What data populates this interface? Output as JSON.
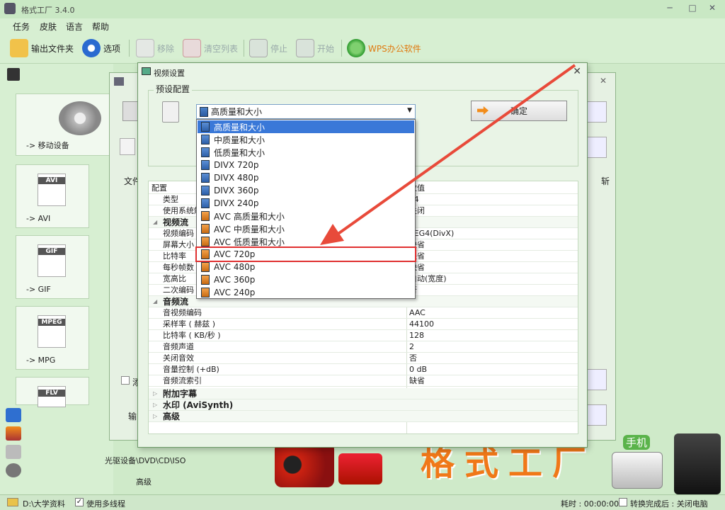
{
  "app": {
    "title": "格式工厂 3.4.0"
  },
  "window_controls": {
    "min": "─",
    "max": "□",
    "close": "✕"
  },
  "menu": [
    "任务",
    "皮肤",
    "语言",
    "帮助"
  ],
  "toolbar": {
    "output_folder": "输出文件夹",
    "options": "选项",
    "remove": "移除",
    "clear_list": "清空列表",
    "stop": "停止",
    "start": "开始",
    "wps": "WPS办公软件"
  },
  "left": {
    "mobile": "-> 移动设备",
    "avi_tag": "AVI",
    "avi": "-> AVI",
    "gif_tag": "GIF",
    "gif": "-> GIF",
    "mpeg_tag": "MPEG",
    "mpg": "-> MPG",
    "flv_tag": "FLV"
  },
  "bgdialog": {
    "file_col": "文件",
    "cut_col": "斩",
    "output_lbl": "输",
    "check_lbl": "添"
  },
  "bottom": {
    "device_label": "光驱设备\\DVD\\CD\\ISO",
    "advanced": "高级",
    "brand_text": "格式工厂",
    "phone_text": "手机"
  },
  "dialog": {
    "title": "视频设置",
    "preset_group": "预设配置",
    "selected": "高质量和大小",
    "ok": "确定",
    "options": [
      {
        "label": "高质量和大小",
        "icon": "blue",
        "selected": true
      },
      {
        "label": "中质量和大小",
        "icon": "blue"
      },
      {
        "label": "低质量和大小",
        "icon": "blue"
      },
      {
        "label": "DIVX 720p",
        "icon": "blue"
      },
      {
        "label": "DIVX 480p",
        "icon": "blue"
      },
      {
        "label": "DIVX 360p",
        "icon": "blue"
      },
      {
        "label": "DIVX 240p",
        "icon": "blue"
      },
      {
        "label": "AVC 高质量和大小",
        "icon": "orange"
      },
      {
        "label": "AVC 中质量和大小",
        "icon": "orange"
      },
      {
        "label": "AVC 低质量和大小",
        "icon": "orange"
      },
      {
        "label": "AVC 720p",
        "icon": "orange",
        "highlighted": true
      },
      {
        "label": "AVC 480p",
        "icon": "orange"
      },
      {
        "label": "AVC 360p",
        "icon": "orange"
      },
      {
        "label": "AVC 240p",
        "icon": "orange"
      }
    ],
    "grid": {
      "header_key": "配置",
      "header_val": "数值",
      "rows": [
        {
          "k": "类型",
          "v": "P4"
        },
        {
          "k": "使用系统解",
          "v": "关闭"
        },
        {
          "k": "视频流",
          "section": true
        },
        {
          "k": "视频编码",
          "v": "PEG4(DivX)"
        },
        {
          "k": "屏幕大小",
          "v": "缺省"
        },
        {
          "k": "比特率",
          "v": "缺省"
        },
        {
          "k": "每秒帧数",
          "v": "缺省"
        },
        {
          "k": "宽高比",
          "v": "自动(宽度)"
        },
        {
          "k": "二次编码",
          "v": "否"
        },
        {
          "k": "音频流",
          "section": true
        },
        {
          "k": "音视频编码",
          "v": "AAC"
        },
        {
          "k": "采样率 ( 赫兹 )",
          "v": "44100"
        },
        {
          "k": "比特率 ( KB/秒 )",
          "v": "128"
        },
        {
          "k": "音频声道",
          "v": "2"
        },
        {
          "k": "关闭音效",
          "v": "否"
        },
        {
          "k": "音量控制 (+dB)",
          "v": "0 dB"
        },
        {
          "k": "音频流索引",
          "v": "缺省"
        },
        {
          "k": "附加字幕",
          "section": true,
          "collapsed": true
        },
        {
          "k": "水印 (AviSynth)",
          "section": true,
          "collapsed": true
        },
        {
          "k": "高级",
          "section": true,
          "collapsed": true
        }
      ]
    }
  },
  "status": {
    "path": "D:\\大学资料",
    "multithread": "使用多线程",
    "elapsed_label": "耗时 : 00:00:00",
    "shutdown": "转换完成后 : 关闭电脑"
  },
  "colors": {
    "accent": "#3a78d8",
    "highlight": "#e03030",
    "arrow": "#e84a3a"
  }
}
